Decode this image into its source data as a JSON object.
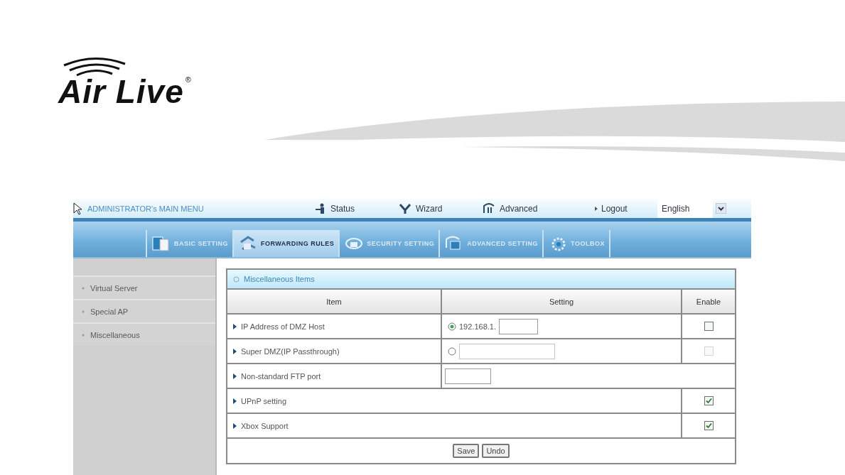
{
  "logo": {
    "text": "Air Live",
    "mark": "®"
  },
  "top_menu": {
    "title": "ADMINISTRATOR's MAIN MENU",
    "links": [
      {
        "label": "Status",
        "kind": "status"
      },
      {
        "label": "Wizard",
        "kind": "wizard"
      },
      {
        "label": "Advanced",
        "kind": "advanced"
      }
    ],
    "logout": "Logout",
    "language": "English"
  },
  "tabs": [
    {
      "label": "BASIC SETTING",
      "kind": "basic",
      "selected": false
    },
    {
      "label": "FORWARDING RULES",
      "kind": "forwarding",
      "selected": true
    },
    {
      "label": "SECURITY SETTING",
      "kind": "security",
      "selected": false
    },
    {
      "label": "ADVANCED SETTING",
      "kind": "advanced",
      "selected": false
    },
    {
      "label": "TOOLBOX",
      "kind": "toolbox",
      "selected": false
    }
  ],
  "sidebar": {
    "items": [
      {
        "label": "Virtual Server"
      },
      {
        "label": "Special AP"
      },
      {
        "label": "Miscellaneous"
      }
    ]
  },
  "panel": {
    "title": "Miscellaneous Items",
    "columns": [
      "Item",
      "Setting",
      "Enable"
    ],
    "rows": [
      {
        "label": "IP Address of DMZ Host",
        "kind": "radio_ip",
        "radio": {
          "selected": true
        },
        "ip_prefix": "192.168.1.",
        "enable": {
          "checked": false,
          "disabled": false
        }
      },
      {
        "label": "Super DMZ(IP Passthrough)",
        "kind": "radio_field",
        "radio": {
          "selected": false
        },
        "enable": {
          "checked": false,
          "disabled": true
        }
      },
      {
        "label": "Non-standard FTP port",
        "kind": "field"
      },
      {
        "label": "UPnP setting",
        "kind": "check",
        "enable": {
          "checked": true,
          "disabled": false
        }
      },
      {
        "label": "Xbox Support",
        "kind": "check",
        "enable": {
          "checked": true,
          "disabled": false
        }
      }
    ],
    "buttons": [
      "Save",
      "Undo"
    ]
  }
}
